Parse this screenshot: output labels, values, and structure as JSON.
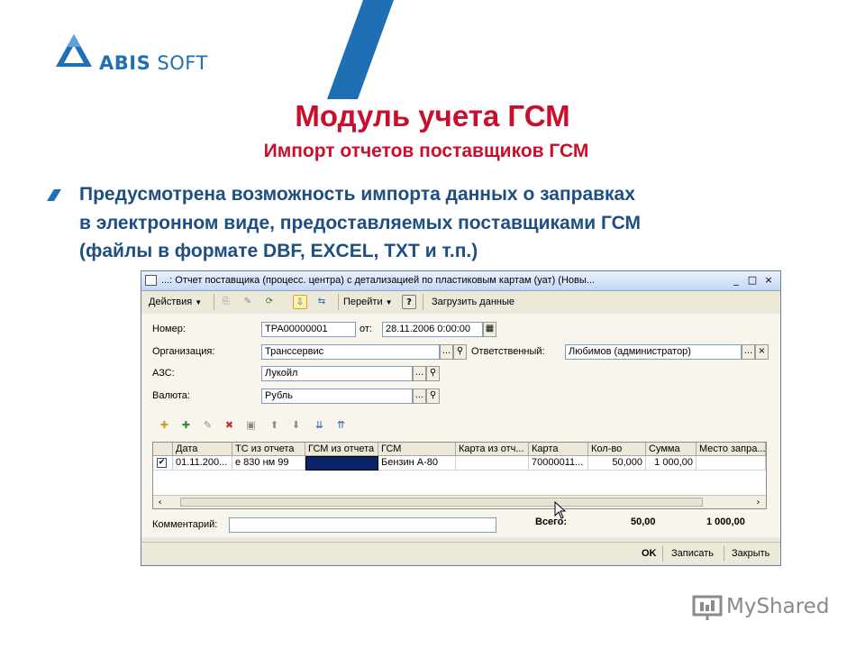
{
  "brand": {
    "name": "ABIS",
    "suffix": " SOFT",
    "color": "#1f6fb5"
  },
  "slide": {
    "title": "Модуль учета ГСМ",
    "subtitle": "Импорт отчетов поставщиков ГСМ",
    "bullet_lines": [
      "Предусмотрена возможность импорта данных о заправках",
      "в электронном виде, предоставляемых поставщиками ГСМ",
      "(файлы в формате DBF, EXCEL, TXT и т.п.)"
    ],
    "title_color": "#c8102e",
    "text_color": "#1e4f80"
  },
  "window": {
    "title": "...: Отчет поставщика (процесс. центра) с детализацией по пластиковым картам (уат) (Новы...",
    "controls": {
      "minimize": "_",
      "maximize": "□",
      "close": "×"
    }
  },
  "toolbar": {
    "actions_label": "Действия",
    "goto_label": "Перейти",
    "help_label": "?",
    "load_label": "Загрузить данные",
    "icons": [
      "copy-icon",
      "edit-icon",
      "refresh-icon",
      "post-icon",
      "help-icon"
    ]
  },
  "form": {
    "number_label": "Номер:",
    "number_value": "ТРА00000001",
    "date_label": "от:",
    "date_value": "28.11.2006 0:00:00",
    "org_label": "Организация:",
    "org_value": "Транссервис",
    "responsible_label": "Ответственный:",
    "responsible_value": "Любимов (администратор)",
    "station_label": "АЗС:",
    "station_value": "Лукойл",
    "currency_label": "Валюта:",
    "currency_value": "Рубль",
    "dots": "...",
    "search": "⚲",
    "clear": "×"
  },
  "table": {
    "columns": [
      "Дата",
      "ТС из отчета",
      "ГСМ из отчета",
      "ГСМ",
      "Карта из отч...",
      "Карта",
      "Кол-во",
      "Сумма",
      "Место запра..."
    ],
    "rows": [
      {
        "checked": true,
        "date": "01.11.200...",
        "vehicle": "е 830 нм 99",
        "fuel_report": "",
        "fuel": "Бензин А-80",
        "card_report": "",
        "card": "70000011...",
        "qty": "50,000",
        "sum": "1 000,00",
        "place": ""
      }
    ]
  },
  "footer": {
    "comment_label": "Комментарий:",
    "comment_value": "",
    "total_label": "Всего:",
    "total_qty": "50,00",
    "total_sum": "1 000,00"
  },
  "statusbar": {
    "ok": "OK",
    "save": "Записать",
    "close": "Закрыть"
  },
  "watermark": {
    "text": "MyShared"
  }
}
